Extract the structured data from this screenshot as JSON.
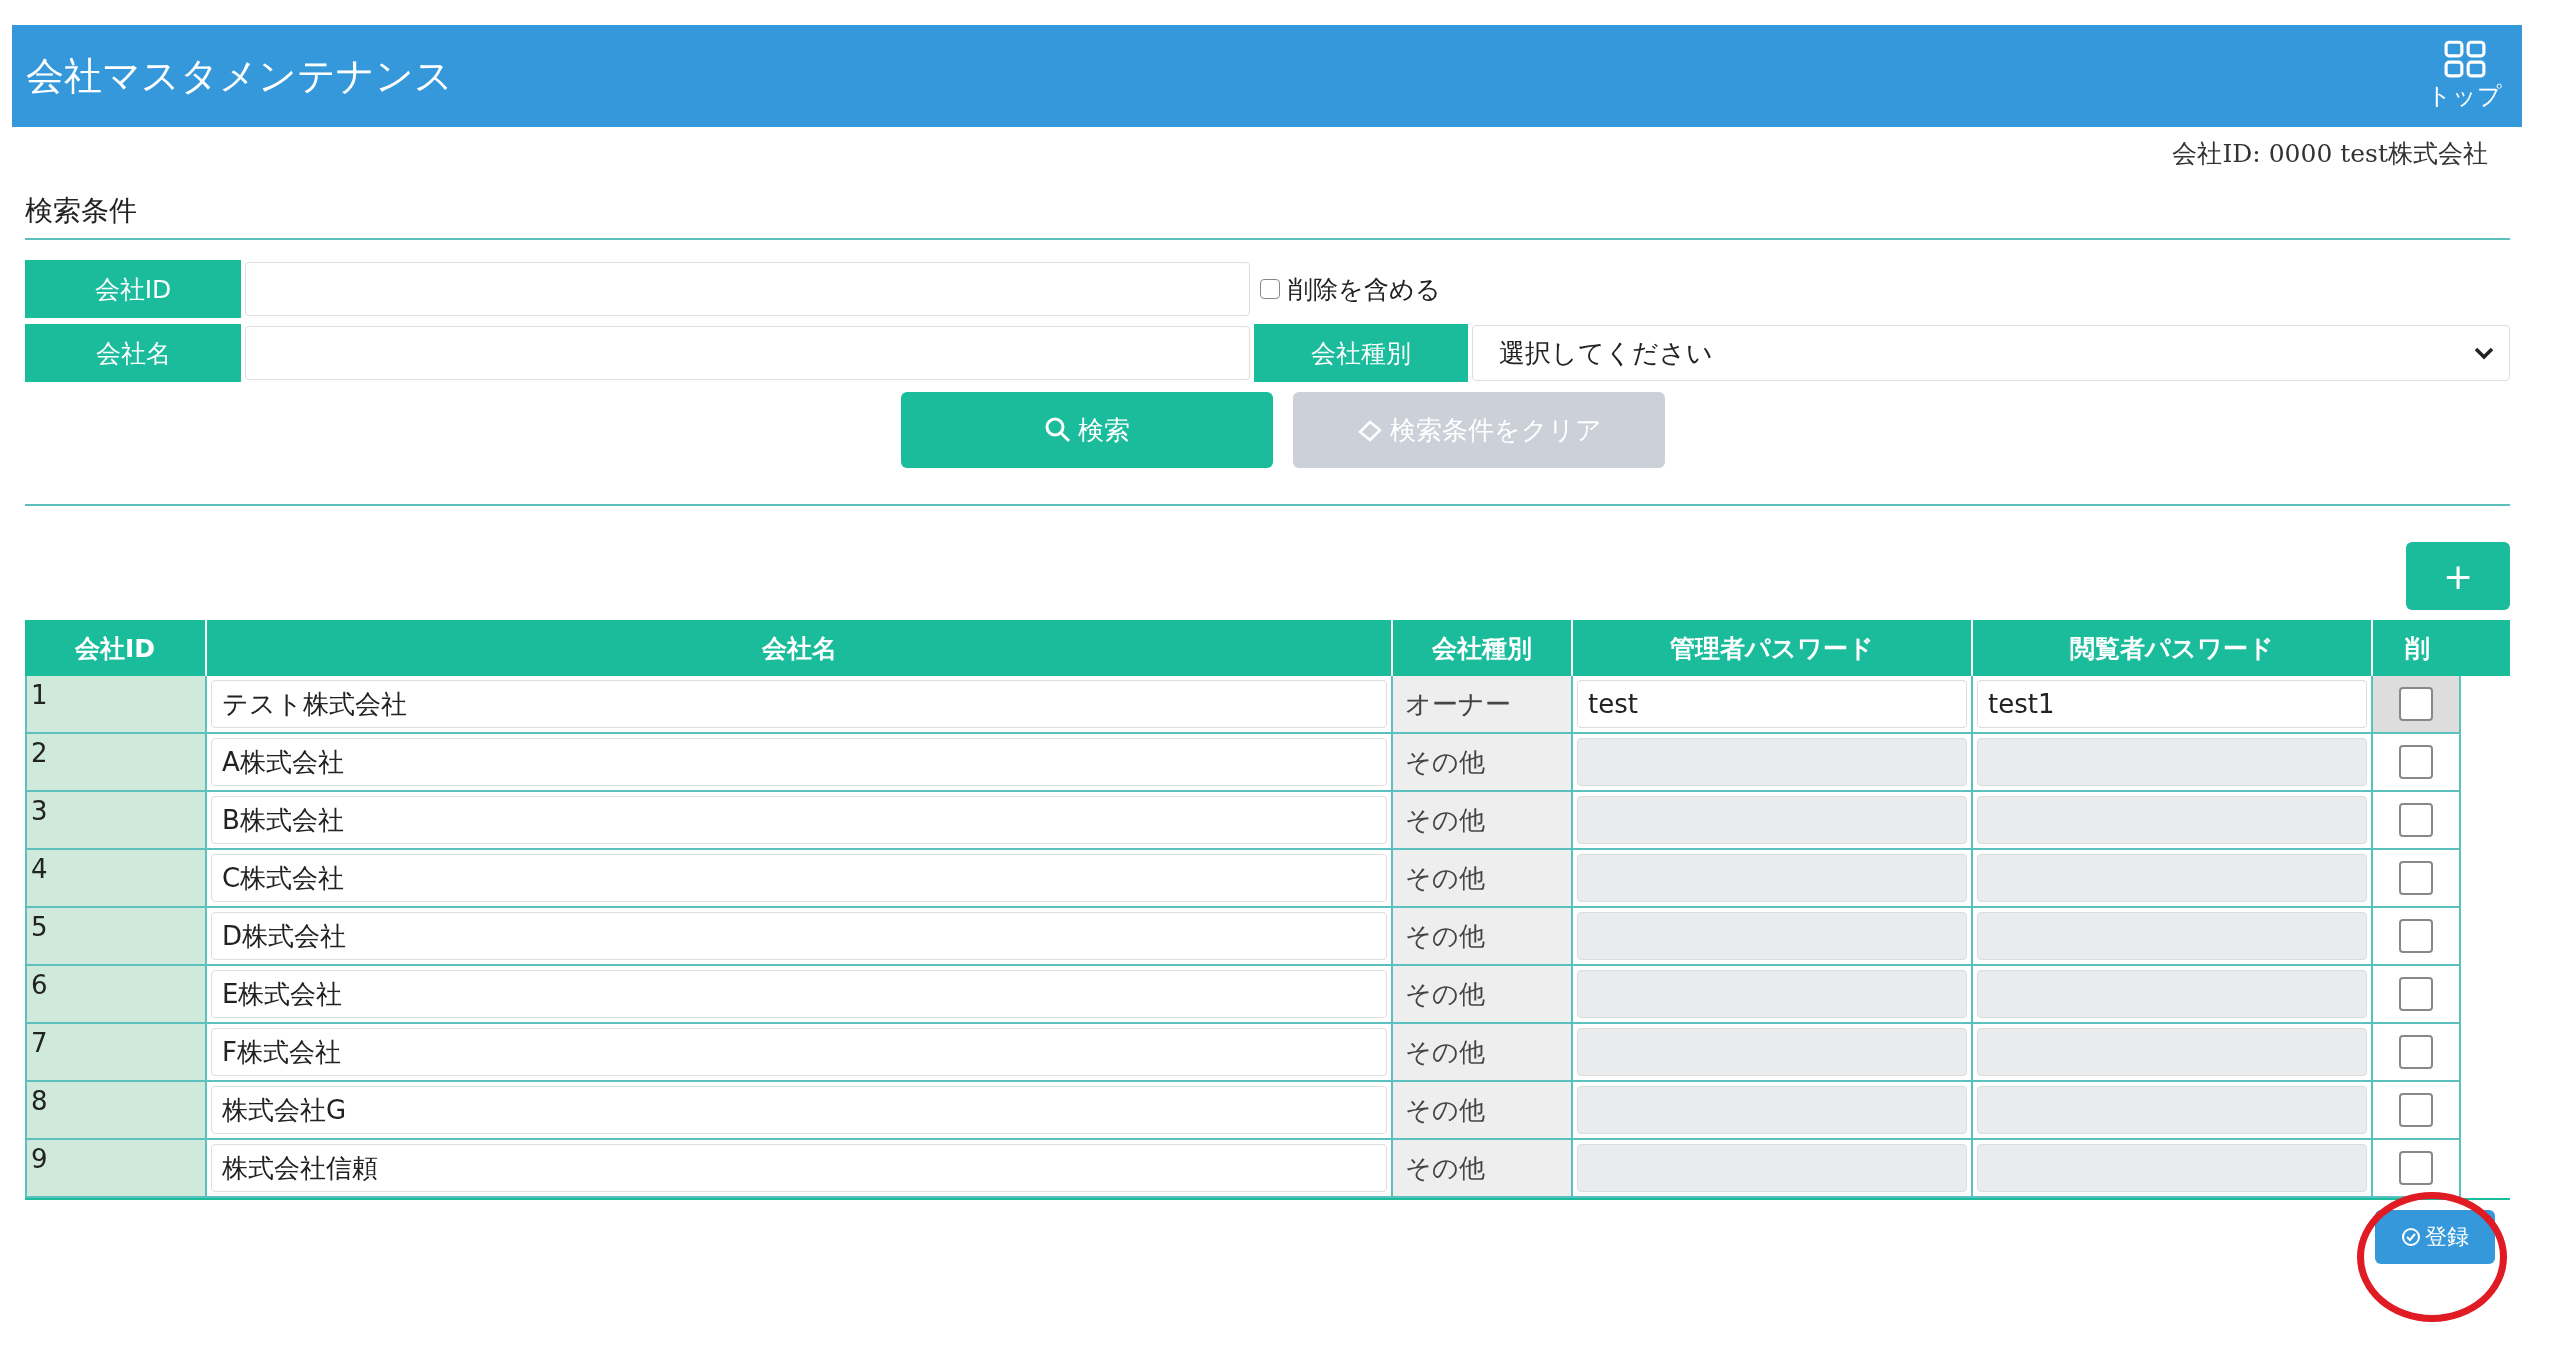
{
  "header": {
    "title": "会社マスタメンテナンス",
    "top_button": "トップ"
  },
  "user_info": "会社ID:  0000  test株式会社",
  "search": {
    "title": "検索条件",
    "company_id_label": "会社ID",
    "company_name_label": "会社名",
    "include_deleted": {
      "label": "削除を含める",
      "checked": false
    },
    "type_label": "会社種別",
    "type_select": "選択してください",
    "search_button": "検索",
    "clear_button": {
      "label": "検索条件をクリア",
      "disabled": true
    }
  },
  "add_button": "+",
  "table": {
    "columns": [
      "会社ID",
      "会社名",
      "会社種別",
      "管理者パスワード",
      "閲覧者パスワード",
      "削"
    ],
    "rows": [
      {
        "id": "1",
        "name": "テスト株式会社",
        "type": "オーナー",
        "admin_password": "test",
        "viewer_password": "test1",
        "passwords_disabled": false,
        "deletable": false,
        "checked": false
      },
      {
        "id": "2",
        "name": "A株式会社",
        "type": "その他",
        "passwords_disabled": true,
        "deletable": true,
        "checked": false
      },
      {
        "id": "3",
        "name": "B株式会社",
        "type": "その他",
        "passwords_disabled": true,
        "deletable": true,
        "checked": false
      },
      {
        "id": "4",
        "name": "C株式会社",
        "type": "その他",
        "passwords_disabled": true,
        "deletable": true,
        "checked": false
      },
      {
        "id": "5",
        "name": "D株式会社",
        "type": "その他",
        "passwords_disabled": true,
        "deletable": true,
        "checked": false
      },
      {
        "id": "6",
        "name": "E株式会社",
        "type": "その他",
        "passwords_disabled": true,
        "deletable": true,
        "checked": false
      },
      {
        "id": "7",
        "name": "F株式会社",
        "type": "その他",
        "passwords_disabled": true,
        "deletable": true,
        "checked": false
      },
      {
        "id": "8",
        "name": "株式会社G",
        "type": "その他",
        "passwords_disabled": true,
        "deletable": true,
        "checked": false
      },
      {
        "id": "9",
        "name": "株式会社信頼",
        "type": "その他",
        "passwords_disabled": true,
        "deletable": true,
        "checked": false
      }
    ]
  },
  "register_button": "登録"
}
